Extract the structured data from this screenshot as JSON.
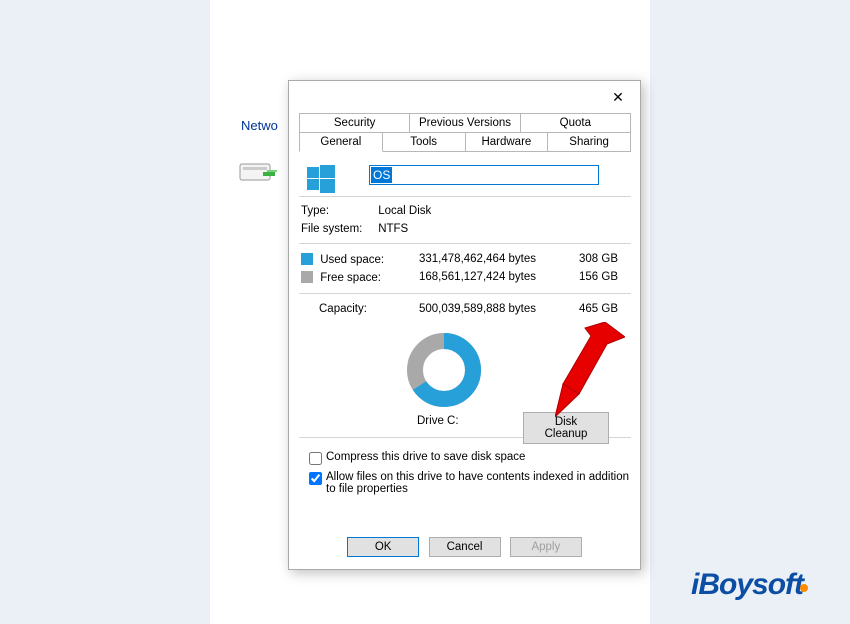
{
  "background": {
    "network_label": "Netwo",
    "watermark_text": "iBoysoft"
  },
  "dialog": {
    "tabs_top": [
      "Security",
      "Previous Versions",
      "Quota"
    ],
    "tabs_bottom": [
      "General",
      "Tools",
      "Hardware",
      "Sharing"
    ],
    "active_tab": "General",
    "drive_name": "OS",
    "type_label": "Type:",
    "type_value": "Local Disk",
    "fs_label": "File system:",
    "fs_value": "NTFS",
    "used_label": "Used space:",
    "used_bytes": "331,478,462,464 bytes",
    "used_human": "308 GB",
    "used_color": "#27a0da",
    "free_label": "Free space:",
    "free_bytes": "168,561,127,424 bytes",
    "free_human": "156 GB",
    "free_color": "#a9a9a9",
    "capacity_label": "Capacity:",
    "capacity_bytes": "500,039,589,888 bytes",
    "capacity_human": "465 GB",
    "drive_caption": "Drive C:",
    "disk_cleanup": "Disk Cleanup",
    "compress_label": "Compress this drive to save disk space",
    "index_label": "Allow files on this drive to have contents indexed in addition to file properties",
    "compress_checked": false,
    "index_checked": true,
    "ok": "OK",
    "cancel": "Cancel",
    "apply": "Apply"
  },
  "chart_data": {
    "type": "pie",
    "title": "Drive C: usage",
    "series": [
      {
        "name": "Used space",
        "value": 308,
        "unit": "GB",
        "color": "#27a0da"
      },
      {
        "name": "Free space",
        "value": 156,
        "unit": "GB",
        "color": "#a9a9a9"
      }
    ],
    "total": {
      "name": "Capacity",
      "value": 465,
      "unit": "GB"
    }
  }
}
